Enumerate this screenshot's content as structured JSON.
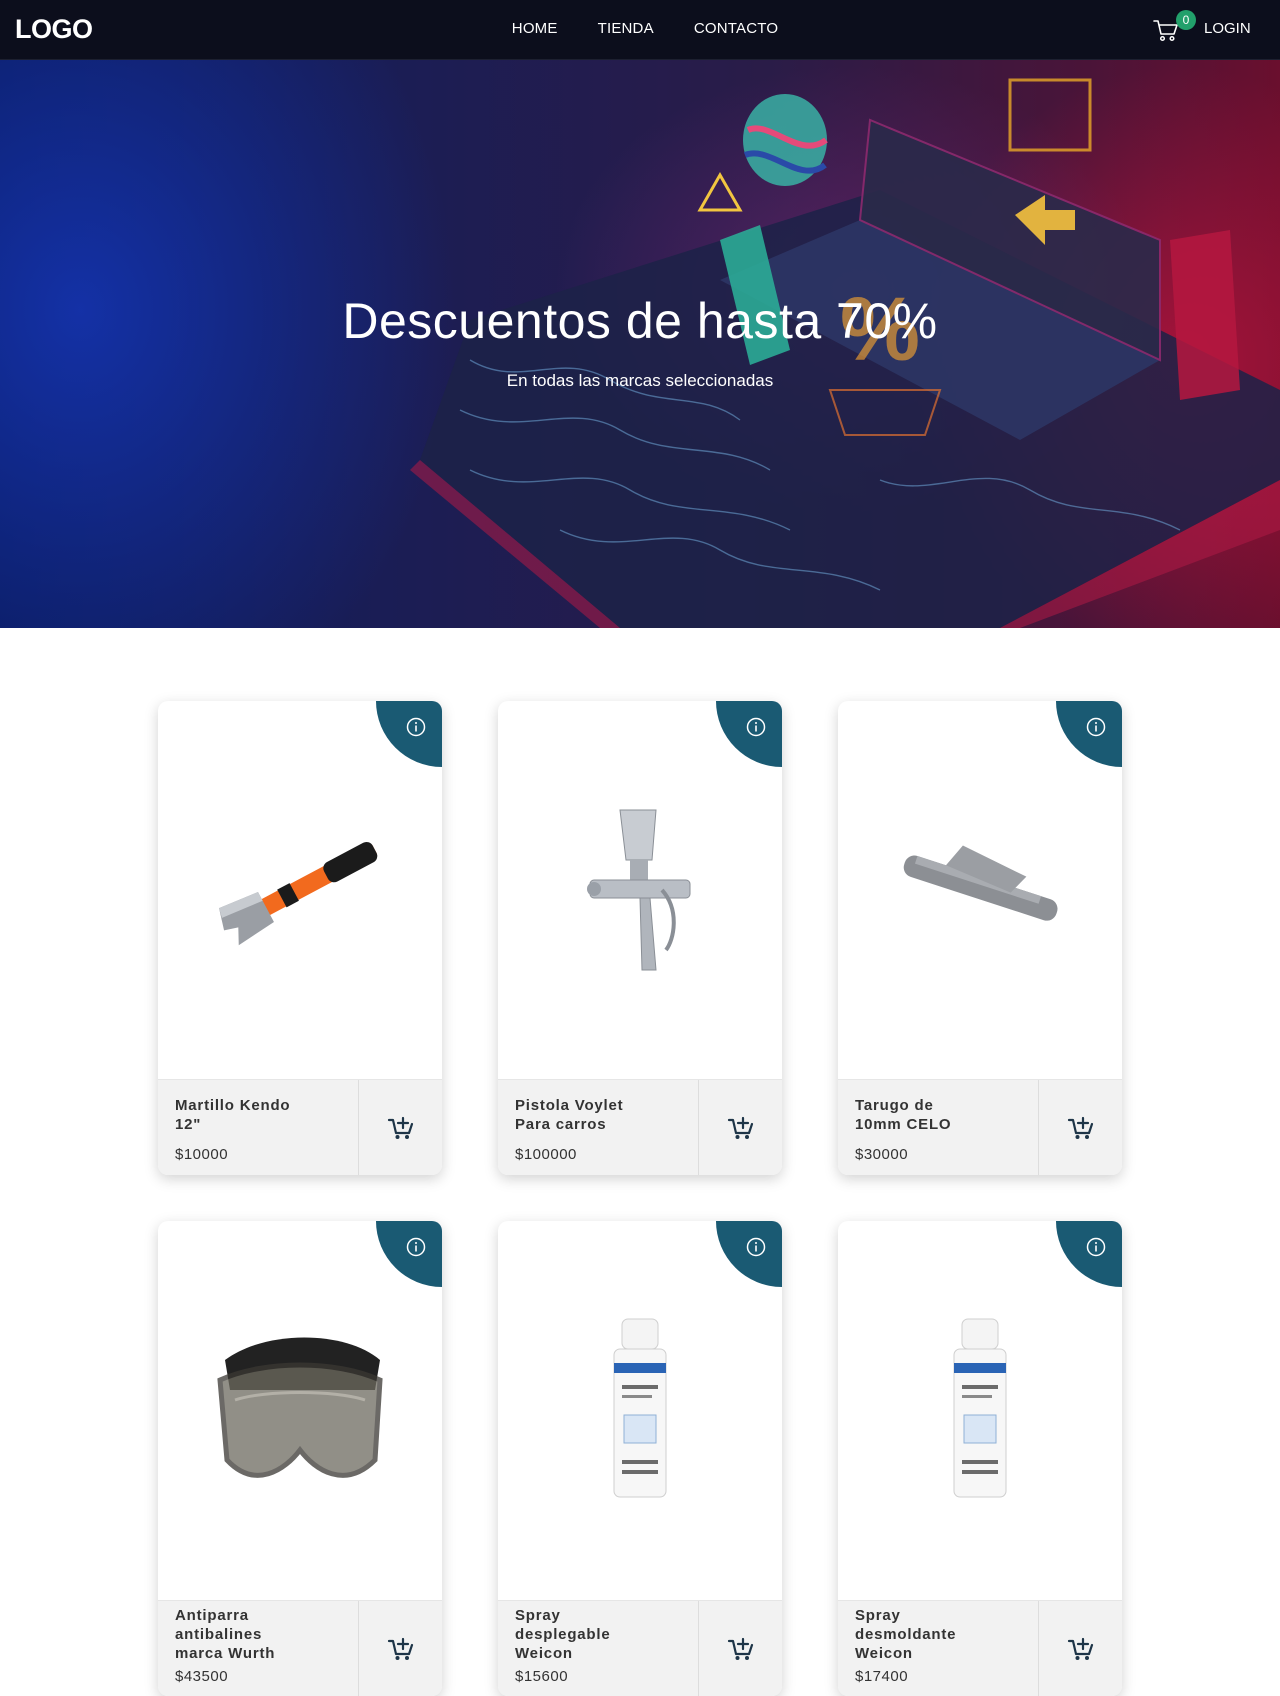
{
  "nav": {
    "logo": "LOGO",
    "links": [
      "HOME",
      "TIENDA",
      "CONTACTO"
    ],
    "cart_count": "0",
    "login": "LOGIN"
  },
  "hero": {
    "title": "Descuentos de hasta 70%",
    "subtitle": "En todas las marcas seleccionadas"
  },
  "products": [
    {
      "name": "Martillo Kendo 12\"",
      "price": "$10000",
      "image": "hammer"
    },
    {
      "name": "Pistola Voylet Para carros",
      "price": "$100000",
      "image": "spray-gun"
    },
    {
      "name": "Tarugo de 10mm CELO",
      "price": "$30000",
      "image": "wall-plug"
    },
    {
      "name": "Antiparra antibalines marca Wurth",
      "price": "$43500",
      "image": "safety-goggles"
    },
    {
      "name": "Spray desplegable Weicon",
      "price": "$15600",
      "image": "spray-can"
    },
    {
      "name": "Spray desmoldante Weicon",
      "price": "$17400",
      "image": "spray-can"
    }
  ],
  "colors": {
    "nav_bg": "#0c0e1c",
    "corner_accent": "#1a5a73",
    "cart_badge": "#22a06b",
    "card_footer": "#f2f2f2",
    "add_to_cart_icon": "#1e3548"
  }
}
